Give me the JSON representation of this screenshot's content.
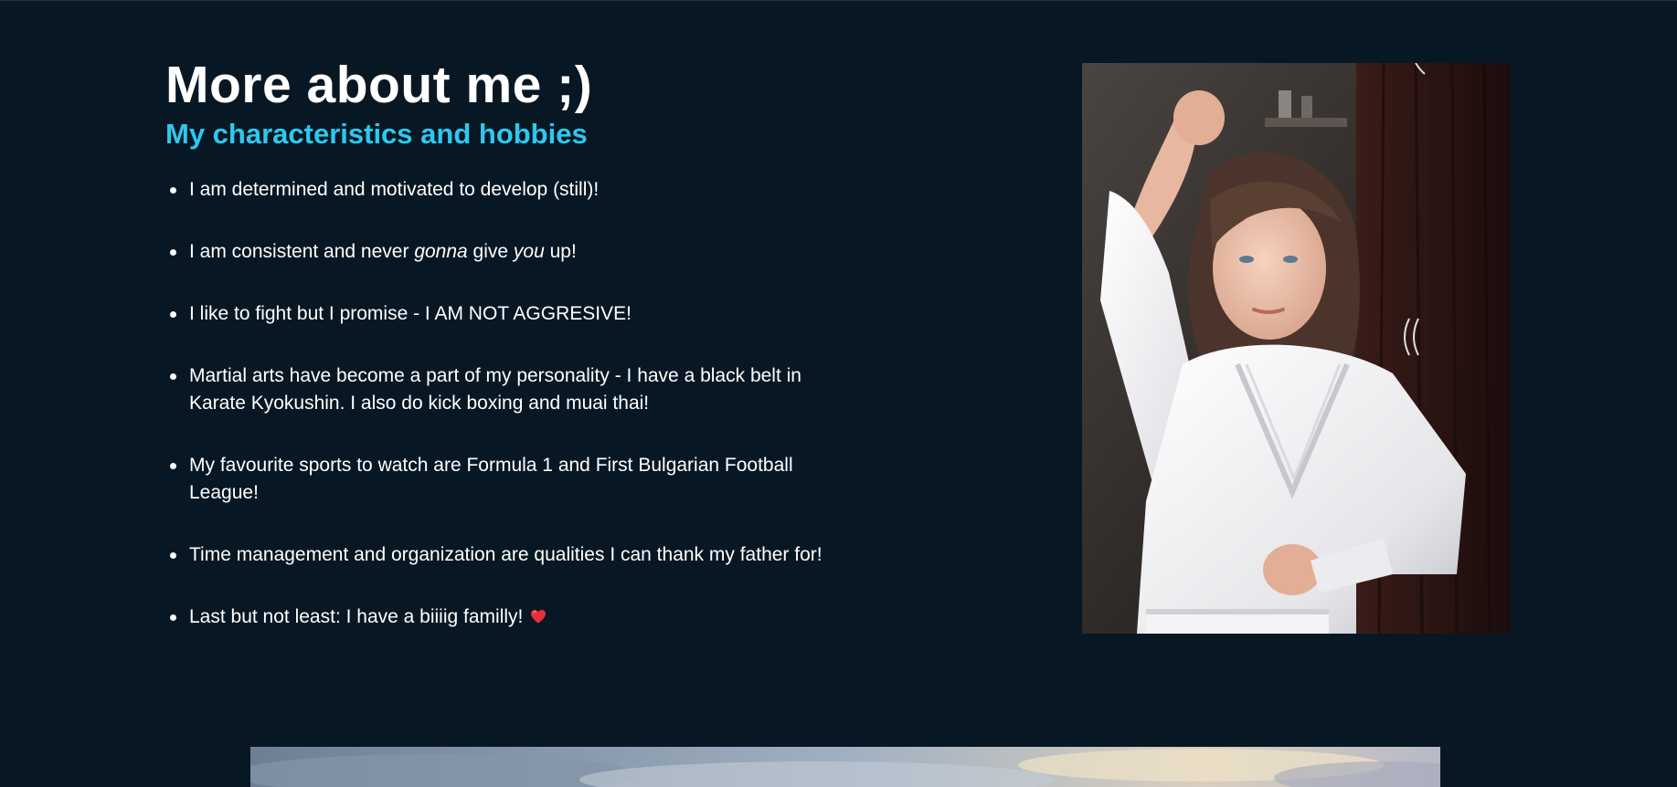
{
  "about": {
    "title": "More about me ;)",
    "subtitle": "My characteristics and hobbies",
    "items": [
      {
        "pre": "I am determined and motivated to develop (still)!"
      },
      {
        "pre": "I am consistent and never ",
        "em1": "gonna",
        "mid": " give ",
        "em2": "you",
        "post": " up!"
      },
      {
        "pre": "I like to fight but I promise - I AM NOT AGGRESIVE!"
      },
      {
        "pre": "Martial arts have become a part of my personality - I have a black belt in Karate Kyokushin. I also do kick boxing and muai thai!"
      },
      {
        "pre": "My favourite sports to watch are Formula 1 and First Bulgarian Football League!"
      },
      {
        "pre": "Time management and organization are qualities I can thank my father for!"
      },
      {
        "pre": "Last but not least: I have a biiiig familly!",
        "icon": "heart-icon"
      }
    ]
  },
  "photo": {
    "alt": "girl in white karate gi in a fighting pose"
  },
  "banner": {
    "alt": "sky landscape photo"
  },
  "colors": {
    "background": "#071824",
    "accent": "#2ec8ef",
    "text": "#ffffff",
    "heart": "#e8303a"
  }
}
